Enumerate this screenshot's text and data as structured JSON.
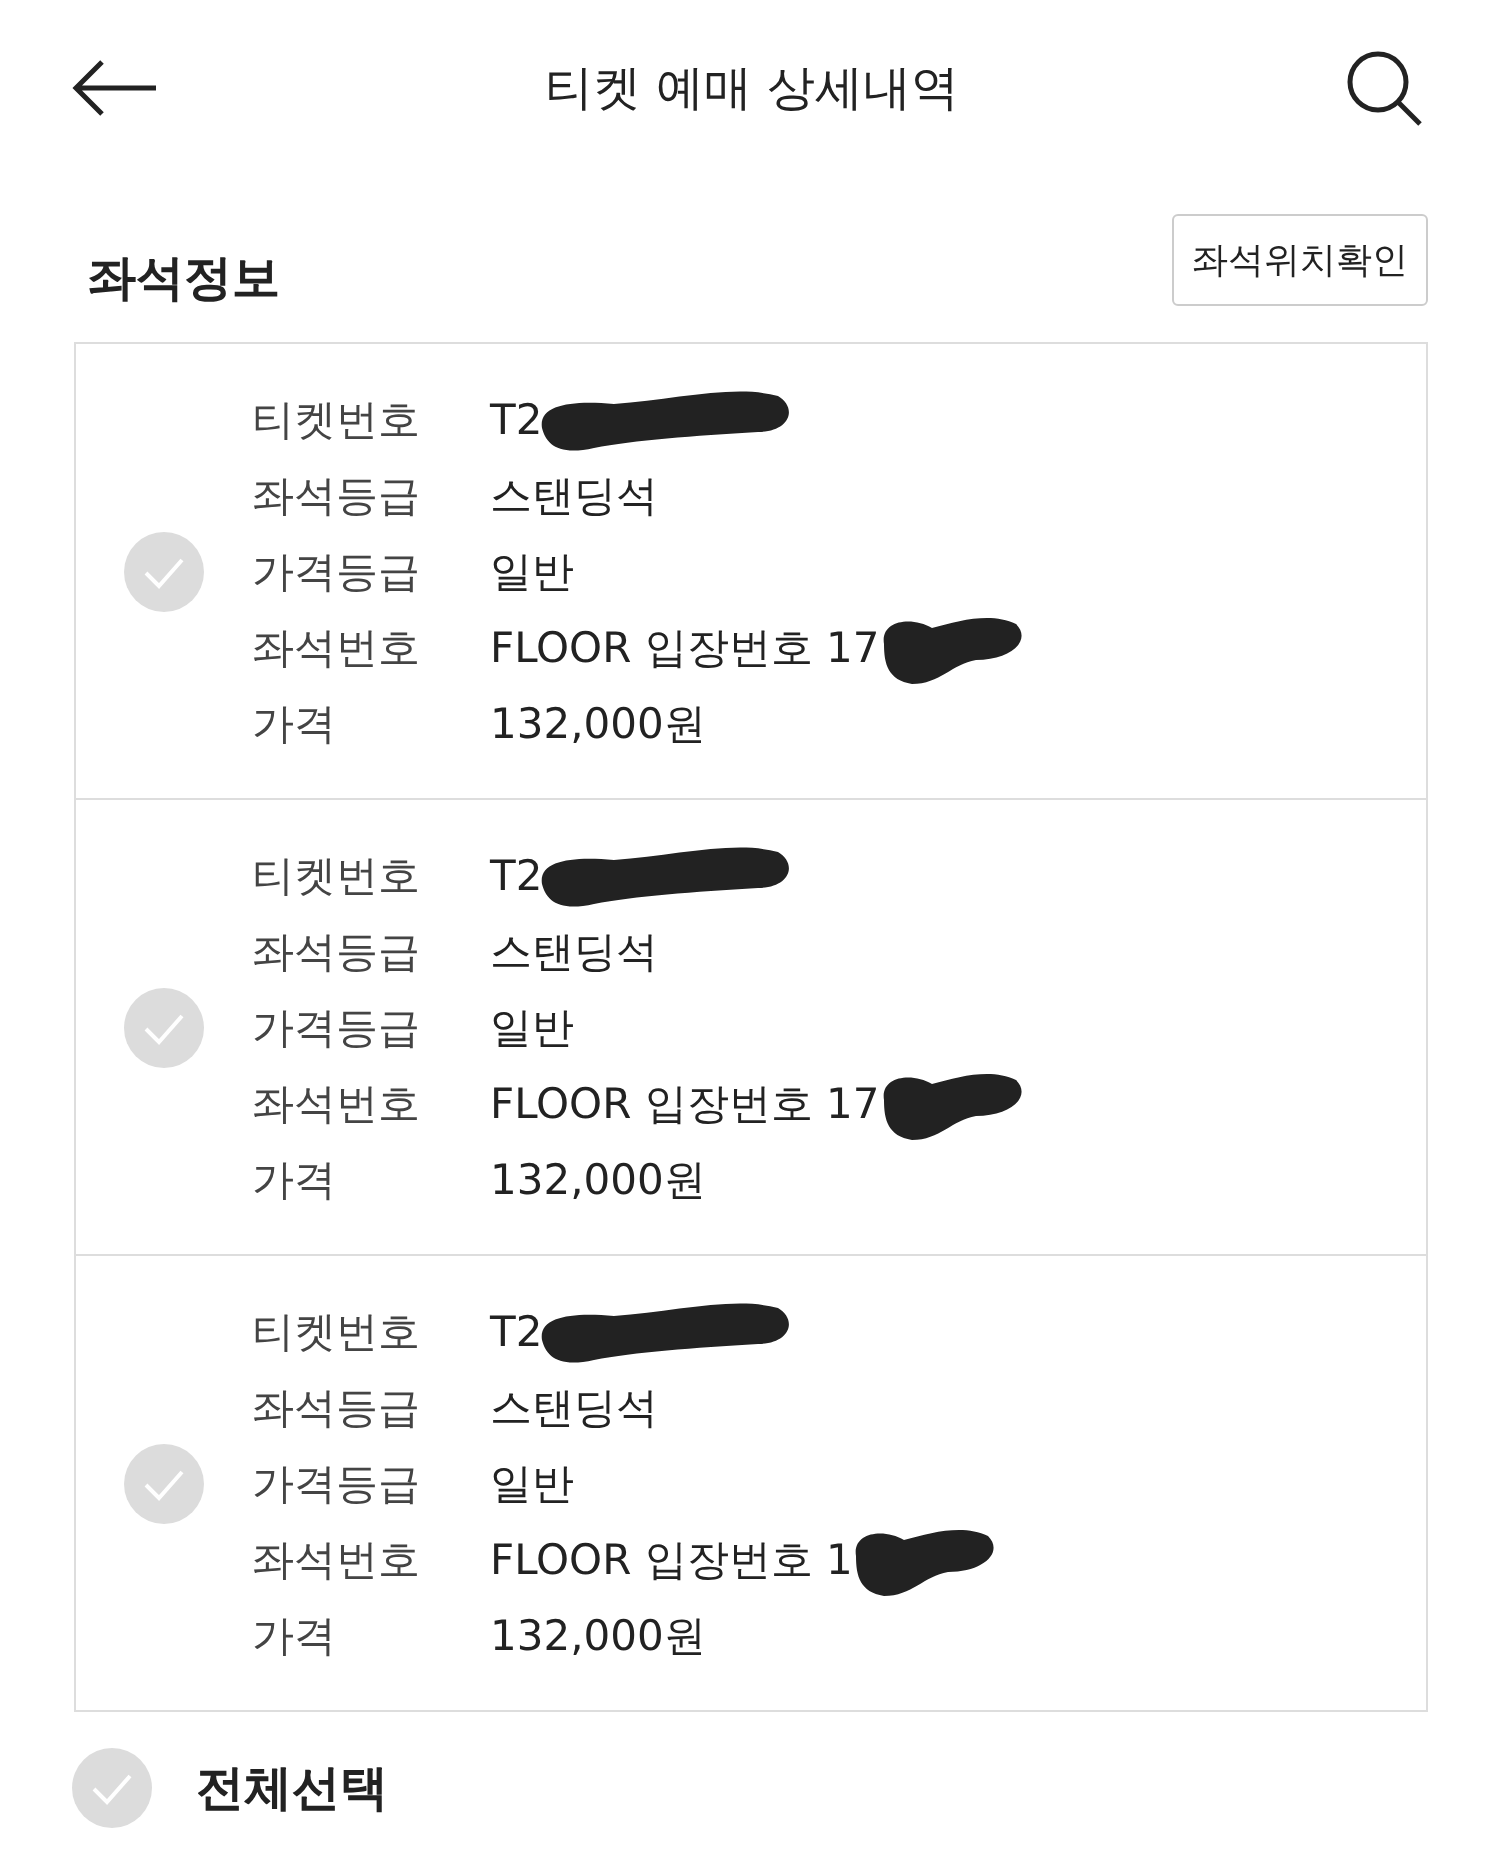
{
  "header": {
    "title": "티켓 예매 상세내역"
  },
  "section": {
    "title": "좌석정보",
    "button": "좌석위치확인"
  },
  "tickets": [
    {
      "checked": false,
      "rows": [
        {
          "label": "티켓번호",
          "value": "T2",
          "redacted": true
        },
        {
          "label": "좌석등급",
          "value": "스탠딩석",
          "redacted": false
        },
        {
          "label": "가격등급",
          "value": "일반",
          "redacted": false
        },
        {
          "label": "좌석번호",
          "value": "FLOOR 입장번호 17",
          "redacted": true
        },
        {
          "label": "가격",
          "value": "132,000원",
          "redacted": false
        }
      ]
    },
    {
      "checked": false,
      "rows": [
        {
          "label": "티켓번호",
          "value": "T2",
          "redacted": true
        },
        {
          "label": "좌석등급",
          "value": "스탠딩석",
          "redacted": false
        },
        {
          "label": "가격등급",
          "value": "일반",
          "redacted": false
        },
        {
          "label": "좌석번호",
          "value": "FLOOR 입장번호 17",
          "redacted": true
        },
        {
          "label": "가격",
          "value": "132,000원",
          "redacted": false
        }
      ]
    },
    {
      "checked": false,
      "rows": [
        {
          "label": "티켓번호",
          "value": "T2",
          "redacted": true
        },
        {
          "label": "좌석등급",
          "value": "스탠딩석",
          "redacted": false
        },
        {
          "label": "가격등급",
          "value": "일반",
          "redacted": false
        },
        {
          "label": "좌석번호",
          "value": "FLOOR 입장번호 1",
          "redacted": true
        },
        {
          "label": "가격",
          "value": "132,000원",
          "redacted": false
        }
      ]
    }
  ],
  "select_all": {
    "label": "전체선택",
    "checked": false
  }
}
